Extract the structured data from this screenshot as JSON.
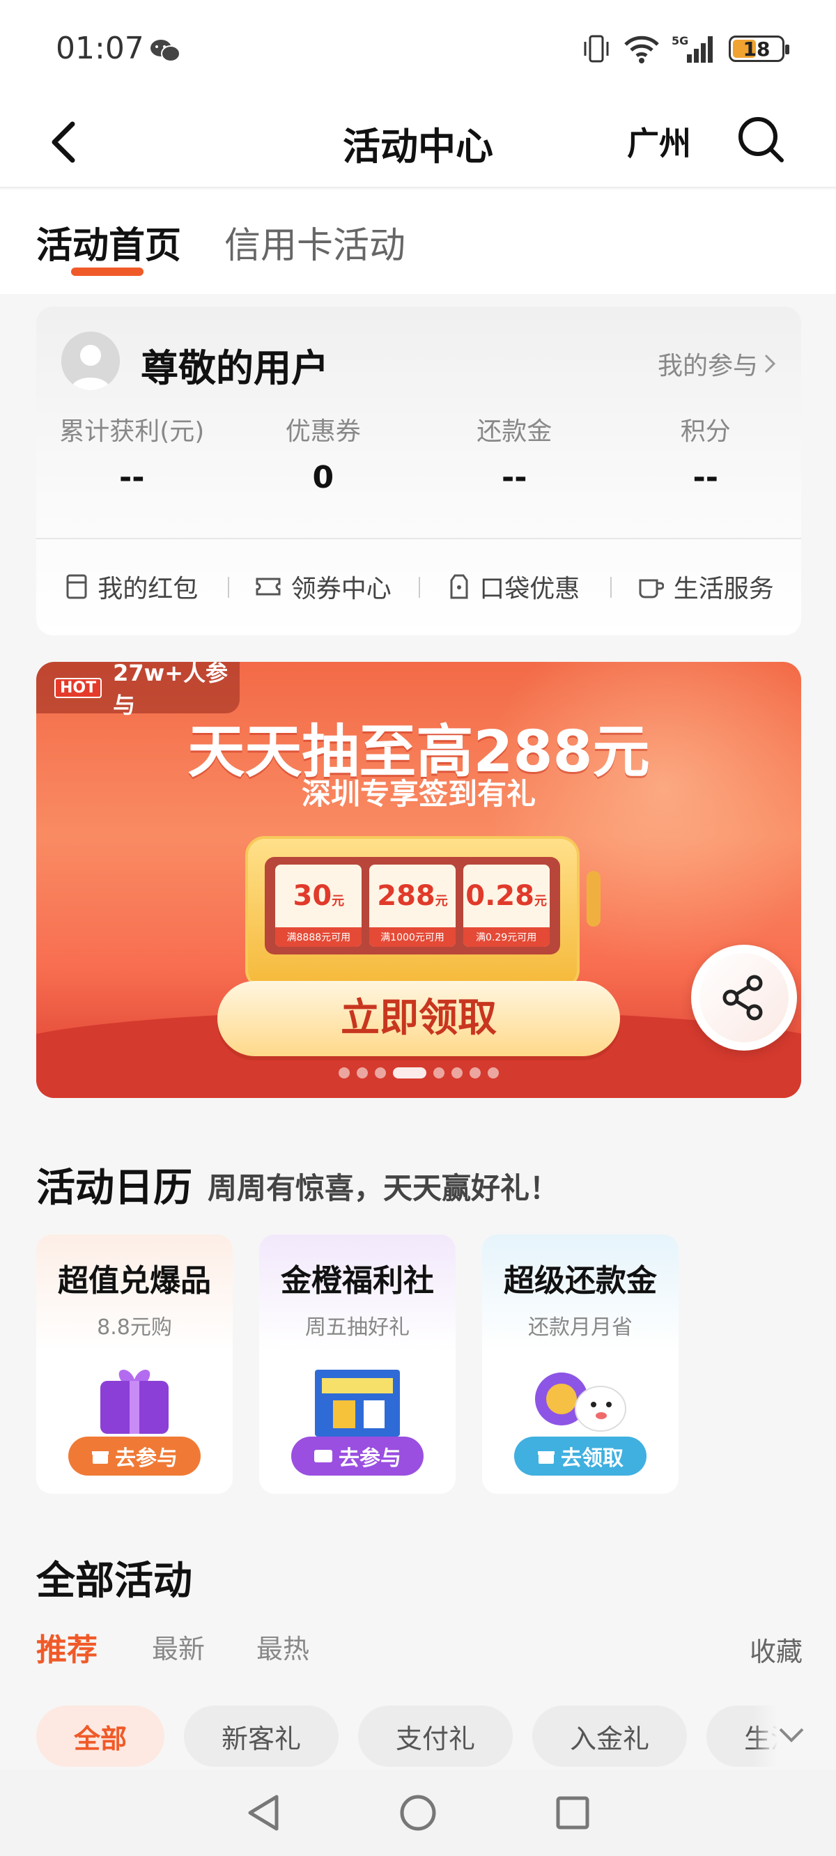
{
  "status_bar": {
    "time": "01:07",
    "battery": "18"
  },
  "nav": {
    "title": "活动中心",
    "city": "广州"
  },
  "tabs": [
    {
      "label": "活动首页"
    },
    {
      "label": "信用卡活动"
    }
  ],
  "user_card": {
    "name": "尊敬的用户",
    "my_participation": "我的参与",
    "stats": [
      {
        "label": "累计获利(元)",
        "value": "--"
      },
      {
        "label": "优惠券",
        "value": "0"
      },
      {
        "label": "还款金",
        "value": "--"
      },
      {
        "label": "积分",
        "value": "--"
      }
    ],
    "quick_links": [
      {
        "label": "我的红包",
        "icon": "red-packet-icon"
      },
      {
        "label": "领券中心",
        "icon": "ticket-icon"
      },
      {
        "label": "口袋优惠",
        "icon": "pocket-icon"
      },
      {
        "label": "生活服务",
        "icon": "cup-icon"
      }
    ]
  },
  "banner": {
    "hot_badge": "HOT",
    "participants": "27w+人参与",
    "title": "天天抽至高288元",
    "subtitle": "深圳专享签到有礼",
    "coupons": [
      {
        "value": "30",
        "unit": "元",
        "condition": "满8888元可用"
      },
      {
        "value": "288",
        "unit": "元",
        "condition": "满1000元可用"
      },
      {
        "value": "0.28",
        "unit": "元",
        "condition": "满0.29元可用"
      }
    ],
    "cta": "立即领取",
    "active_slide": 3,
    "slide_count": 8
  },
  "calendar": {
    "title": "活动日历",
    "subtitle": "周周有惊喜，天天赢好礼！",
    "cards": [
      {
        "title": "超值兑爆品",
        "sub": "8.8元购",
        "button": "去参与",
        "color": "#f07a35"
      },
      {
        "title": "金橙福利社",
        "sub": "周五抽好礼",
        "button": "去参与",
        "color": "#9a4fe0"
      },
      {
        "title": "超级还款金",
        "sub": "还款月月省",
        "button": "去领取",
        "color": "#3fb0e0"
      }
    ]
  },
  "all_activities": {
    "title": "全部活动",
    "sort_tabs": [
      "推荐",
      "最新",
      "最热"
    ],
    "favorites": "收藏",
    "chips": [
      "全部",
      "新客礼",
      "支付礼",
      "入金礼",
      "生活"
    ]
  },
  "colors": {
    "accent": "#f05a28"
  }
}
